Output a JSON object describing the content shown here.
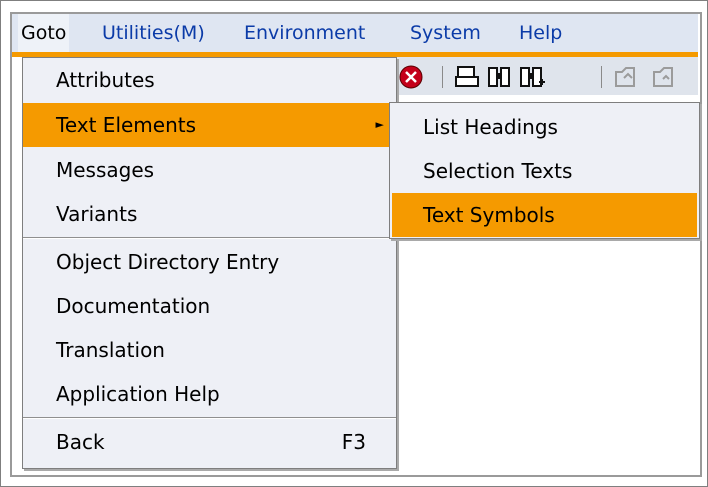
{
  "menubar": {
    "items": [
      {
        "label": "Goto"
      },
      {
        "label": "Utilities(M)"
      },
      {
        "label": "Environment"
      },
      {
        "label": "System"
      },
      {
        "label": "Help"
      }
    ]
  },
  "goto_menu": {
    "items": [
      {
        "label": "Attributes"
      },
      {
        "label": "Text Elements"
      },
      {
        "label": "Messages"
      },
      {
        "label": "Variants"
      },
      {
        "label": "Object Directory Entry"
      },
      {
        "label": "Documentation"
      },
      {
        "label": "Translation"
      },
      {
        "label": "Application Help"
      },
      {
        "label": "Back",
        "shortcut": "F3"
      }
    ]
  },
  "text_elements_submenu": {
    "items": [
      {
        "label": "List Headings"
      },
      {
        "label": "Selection Texts"
      },
      {
        "label": "Text Symbols"
      }
    ]
  },
  "toolbar": {
    "icons": [
      "cancel-icon",
      "print-icon",
      "find-icon",
      "find-next-icon",
      "first-page-icon",
      "previous-page-icon"
    ]
  },
  "colors": {
    "highlight": "#f59a00",
    "menubar_bg": "#dfe6f2",
    "menu_link": "#0b3ba8",
    "menu_bg": "#eef0f6"
  }
}
